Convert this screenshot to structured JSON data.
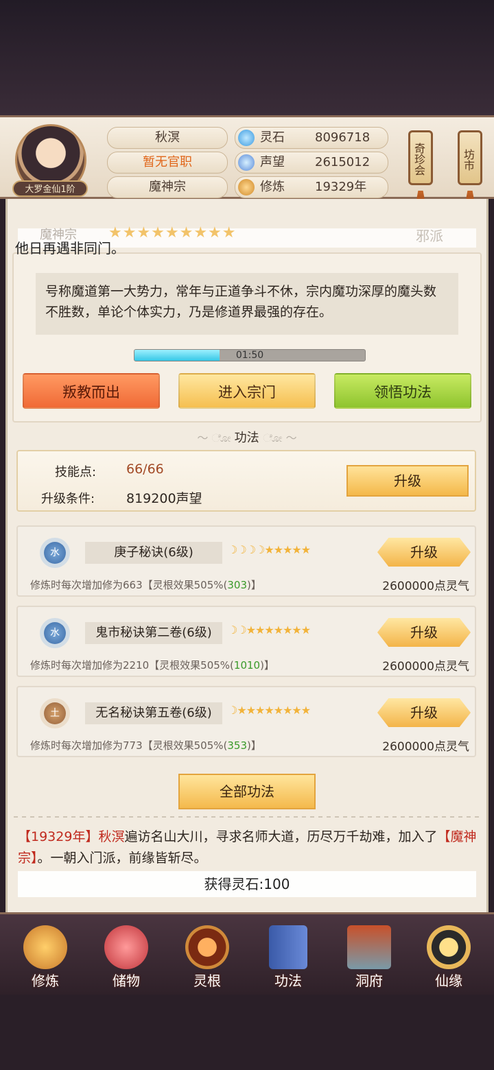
{
  "header": {
    "rank": "大罗金仙1阶",
    "name": "秋溟",
    "official_title": "暂无官职",
    "sect": "魔神宗",
    "resources": [
      {
        "label": "灵石",
        "value": "8096718"
      },
      {
        "label": "声望",
        "value": "2615012"
      },
      {
        "label": "修炼",
        "value": "19329年"
      }
    ],
    "side_buttons": [
      "奇珍会",
      "坊市"
    ]
  },
  "sect_panel": {
    "ghost_name": "魔神宗",
    "stars": "★★★★★★★★★",
    "alignment": "邪派",
    "marquee": "他日再遇非同门。",
    "description": "号称魔道第一大势力，常年与正道争斗不休，宗内魔功深厚的魔头数不胜数，单论个体实力，乃是修道界最强的存在。",
    "timer": "01:50",
    "timer_progress": 0.37,
    "buttons": [
      "叛教而出",
      "进入宗门",
      "领悟功法"
    ]
  },
  "skills": {
    "section_title": "功法",
    "points_label": "技能点:",
    "points_value": "66/66",
    "condition_label": "升级条件:",
    "condition_value": "819200声望",
    "upgrade_label": "升级",
    "techniques": [
      {
        "element": "水",
        "element_type": "water",
        "name": "庚子秘诀(6级)",
        "rating": "☽☽☽☽★★★★★",
        "effect_prefix": "修炼时每次增加修为663【灵根效果505%(",
        "effect_bonus": "303",
        "effect_suffix": ")】",
        "cost": "2600000点灵气",
        "button": "升级"
      },
      {
        "element": "水",
        "element_type": "water",
        "name": "鬼市秘诀第二卷(6级)",
        "rating": "☽☽★★★★★★★",
        "effect_prefix": "修炼时每次增加修为2210【灵根效果505%(",
        "effect_bonus": "1010",
        "effect_suffix": ")】",
        "cost": "2600000点灵气",
        "button": "升级"
      },
      {
        "element": "土",
        "element_type": "earth",
        "name": "无名秘诀第五卷(6级)",
        "rating": "☽★★★★★★★★",
        "effect_prefix": "修炼时每次增加修为773【灵根效果505%(",
        "effect_bonus": "353",
        "effect_suffix": ")】",
        "cost": "2600000点灵气",
        "button": "升级"
      }
    ],
    "all_button": "全部功法"
  },
  "log": {
    "year": "【19329年】",
    "name": "秋溟",
    "text1": "遍访名山大川，寻求名师大道，历尽万千劫难，加入了",
    "sect": "【魔神宗】",
    "text2": "。一朝入门派，前缘皆斩尽。",
    "toast": "获得灵石:100"
  },
  "nav": [
    "修炼",
    "储物",
    "灵根",
    "功法",
    "洞府",
    "仙缘"
  ],
  "colors": {
    "accent_gold": "#f4b84a",
    "accent_red": "#c02a1e",
    "accent_green": "#3a9a2a"
  }
}
